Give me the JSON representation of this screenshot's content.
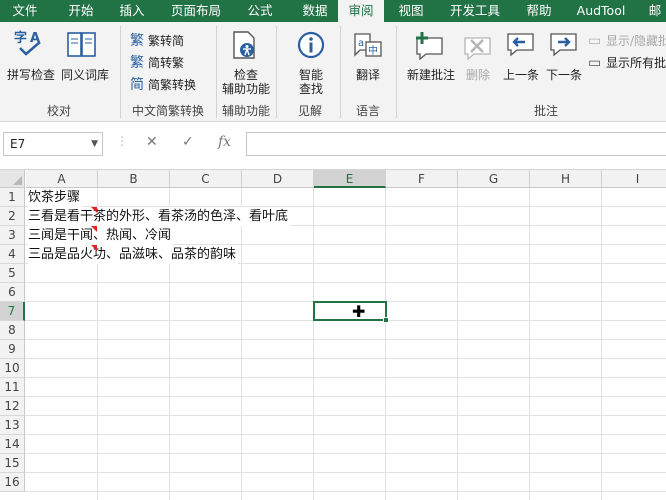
{
  "tabs": [
    "文件",
    "开始",
    "插入",
    "页面布局",
    "公式",
    "数据",
    "审阅",
    "视图",
    "开发工具",
    "帮助",
    "AudTool",
    "邮"
  ],
  "active_tab": "审阅",
  "ribbon": {
    "proofing": {
      "spell": "拼写检查",
      "thesaurus": "同义词库",
      "label": "校对"
    },
    "chinese": {
      "to_trad": "简转繁",
      "to_simp_trad": "繁转简",
      "convert": "简繁转换",
      "label": "中文简繁转换",
      "to_trad_full": "繁转简"
    },
    "access": {
      "check": "检查",
      "check2": "辅助功能",
      "label": "辅助功能"
    },
    "insights": {
      "smart": "智能",
      "smart2": "查找",
      "label": "见解"
    },
    "language": {
      "translate": "翻译",
      "label": "语言"
    },
    "comments": {
      "new": "新建批注",
      "delete": "删除",
      "prev": "上一条",
      "next": "下一条",
      "show_hide": "显示/隐藏批",
      "show_all": "显示所有批",
      "label": "批注"
    }
  },
  "formula_bar": {
    "name_box": "E7",
    "cancel": "✕",
    "enter": "✓",
    "fx": "fx",
    "value": ""
  },
  "columns": [
    "A",
    "B",
    "C",
    "D",
    "E",
    "F",
    "G",
    "H",
    "I"
  ],
  "selected_column": "E",
  "rows": [
    "1",
    "2",
    "3",
    "4",
    "5",
    "6",
    "7",
    "8",
    "9",
    "10",
    "11",
    "12",
    "13",
    "14",
    "15",
    "16"
  ],
  "selected_row": "7",
  "cells": {
    "A1": "饮茶步骤",
    "A2": "三看是看干茶的外形、看茶汤的色泽、看叶底",
    "A3": "三闻是干闻、热闻、冷闻",
    "A4": "三品是品火功、品滋味、品茶的韵味"
  },
  "colors": {
    "accent": "#217346",
    "comment_marker": "#e2231a"
  }
}
